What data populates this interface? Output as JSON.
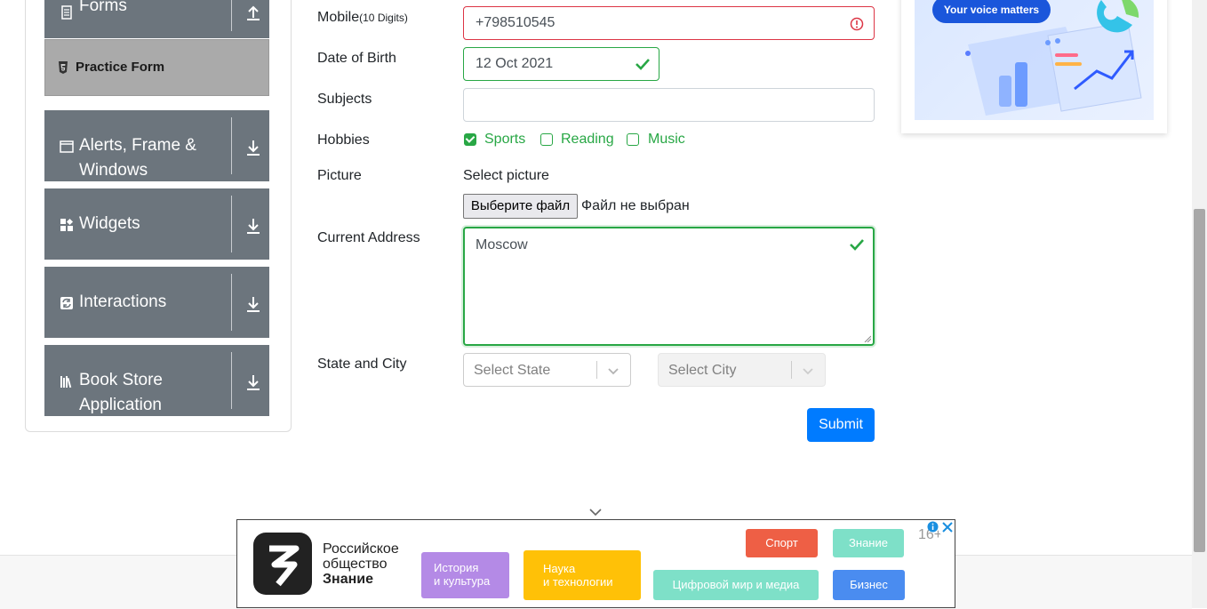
{
  "sidebar": {
    "forms_label": "Forms",
    "practice_form_label": "Practice Form",
    "groups": [
      {
        "label_line1": "Alerts, Frame &",
        "label_line2": "Windows",
        "icon": "window-icon"
      },
      {
        "label": "Widgets",
        "icon": "widgets-icon"
      },
      {
        "label": "Interactions",
        "icon": "interactions-icon"
      },
      {
        "label_line1": "Book Store",
        "label_line2": "Application",
        "icon": "book-icon"
      }
    ]
  },
  "form": {
    "mobile": {
      "label": "Mobile",
      "hint": "(10 Digits)",
      "value": "+798510545",
      "state": "invalid"
    },
    "dob": {
      "label": "Date of Birth",
      "value": "12 Oct 2021",
      "state": "valid"
    },
    "subjects": {
      "label": "Subjects",
      "value": ""
    },
    "hobbies": {
      "label": "Hobbies",
      "options": [
        {
          "label": "Sports",
          "checked": true
        },
        {
          "label": "Reading",
          "checked": false
        },
        {
          "label": "Music",
          "checked": false
        }
      ]
    },
    "picture": {
      "label": "Picture",
      "select_label": "Select picture",
      "button_label": "Выберите файл",
      "status": "Файл не выбран"
    },
    "address": {
      "label": "Current Address",
      "value": "Moscow",
      "state": "valid"
    },
    "state_city": {
      "label": "State and City",
      "state_placeholder": "Select State",
      "city_placeholder": "Select City"
    },
    "submit_label": "Submit"
  },
  "top_ad": {
    "pill_text": "Your voice matters"
  },
  "bottom_ad": {
    "brand_line1": "Российское",
    "brand_line2": "общество",
    "brand_line3": "Знание",
    "age_rating": "16+",
    "tiles": [
      {
        "line1": "История",
        "line2": "и культура",
        "color": "#b48ae6"
      },
      {
        "line1": "Наука",
        "line2": "и технологии",
        "color": "#ffc107"
      },
      {
        "line1": "Цифровой мир и медиа",
        "color": "#7ee0c8"
      },
      {
        "line1": "Спорт",
        "color": "#ee5f45"
      },
      {
        "line1": "Знание",
        "color": "#7ee0c8"
      },
      {
        "line1": "Бизнес",
        "color": "#4a8cf0"
      }
    ]
  },
  "colors": {
    "sidebar_group": "#6c757d",
    "practice_active": "#aaaaaa",
    "valid": "#28a745",
    "invalid": "#dc3545",
    "primary": "#007bff"
  }
}
